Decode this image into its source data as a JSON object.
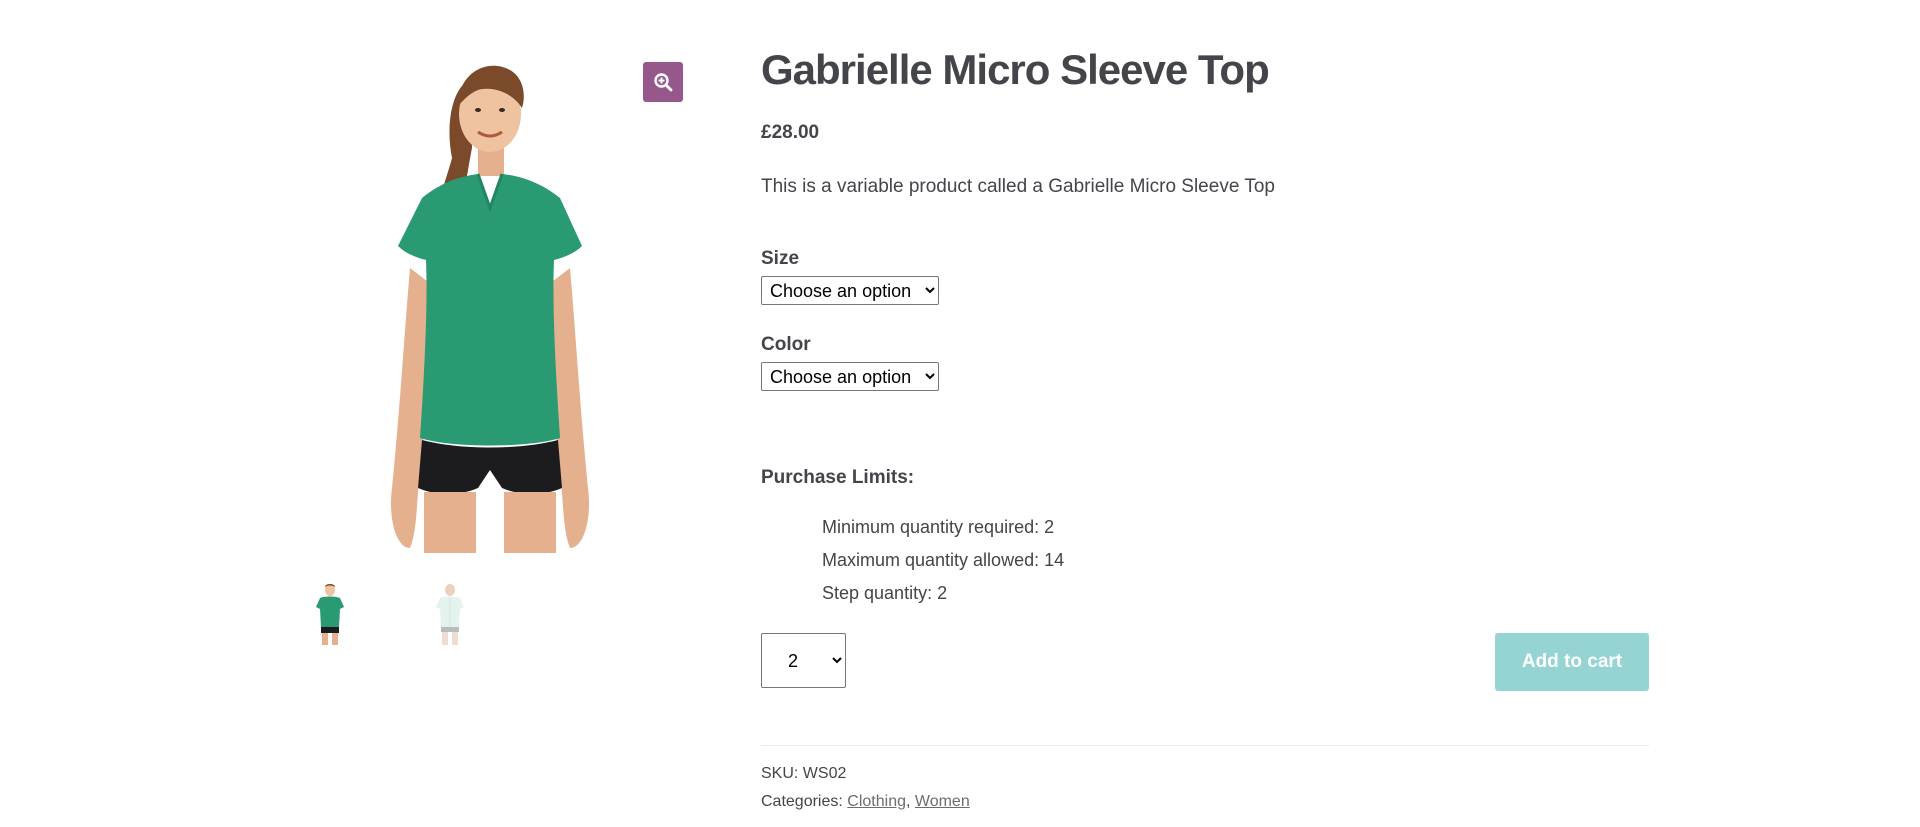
{
  "product": {
    "title": "Gabrielle Micro Sleeve Top",
    "price": "£28.00",
    "description": "This is a variable product called a Gabrielle Micro Sleeve Top"
  },
  "variations": {
    "size_label": "Size",
    "size_value": "Choose an option",
    "color_label": "Color",
    "color_value": "Choose an option"
  },
  "purchase_limits": {
    "title": "Purchase Limits:",
    "items": [
      "Minimum quantity required: 2",
      "Maximum quantity allowed: 14",
      "Step quantity: 2"
    ]
  },
  "cart": {
    "quantity": "2",
    "add_to_cart_label": "Add to cart"
  },
  "meta": {
    "sku_label": "SKU:",
    "sku_value": "WS02",
    "categories_label": "Categories:",
    "categories": [
      "Clothing",
      "Women"
    ],
    "separator": ","
  },
  "icons": {
    "zoom": "zoom-in-icon"
  },
  "colors": {
    "zoom_button": "#96588a",
    "add_to_cart_bg": "#96d4d4",
    "text": "#43454b",
    "shirt_green": "#2a9a73"
  }
}
